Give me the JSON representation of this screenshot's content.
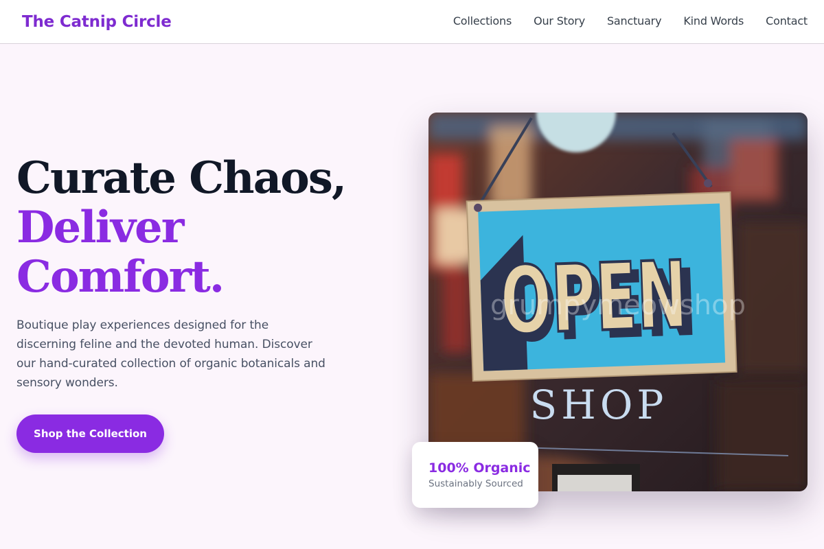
{
  "brand": {
    "name": "The Catnip Circle",
    "accent_color": "#8a2be2"
  },
  "nav": {
    "links": [
      "Collections",
      "Our Story",
      "Sanctuary",
      "Kind Words",
      "Contact"
    ]
  },
  "hero": {
    "title_line1": "Curate Chaos,",
    "title_line2": "Deliver",
    "title_line3": "Comfort.",
    "description": "Boutique play experiences designed for the discerning feline and the devoted human. Discover our hand-curated collection of organic botanicals and sensory wonders.",
    "cta_label": "Shop the Collection"
  },
  "image": {
    "sign_text": "OPEN",
    "window_text": "SHOP",
    "watermark": "grumpymeowshop"
  },
  "badge": {
    "title": "100% Organic",
    "subtitle": "Sustainably Sourced"
  }
}
